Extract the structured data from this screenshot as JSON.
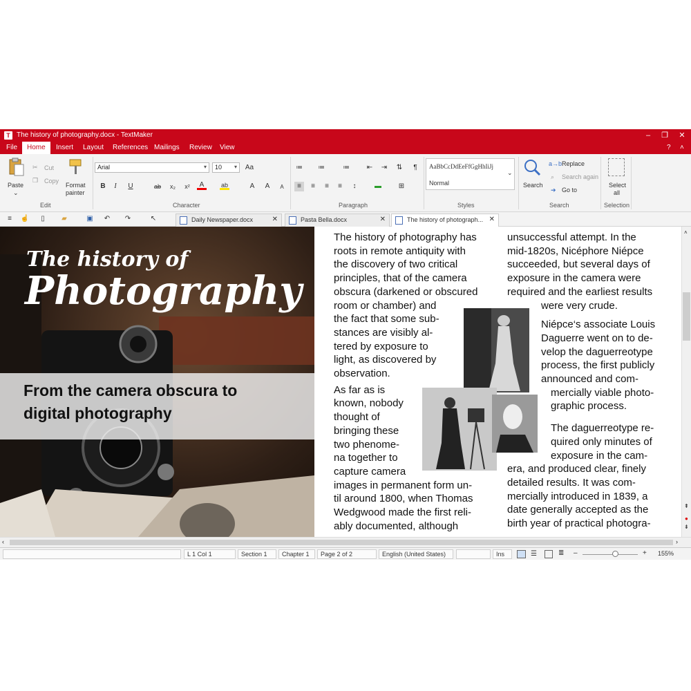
{
  "window": {
    "title": "The history of photography.docx - TextMaker",
    "app_icon": "T"
  },
  "menu": {
    "items": [
      "File",
      "Home",
      "Insert",
      "Layout",
      "References",
      "Mailings",
      "Review",
      "View"
    ],
    "help": "?"
  },
  "ribbon": {
    "edit": {
      "paste": "Paste",
      "cut": "Cut",
      "copy": "Copy",
      "format_painter_1": "Format",
      "format_painter_2": "painter",
      "group": "Edit"
    },
    "character": {
      "font": "Arial",
      "size": "10",
      "group": "Character"
    },
    "paragraph": {
      "group": "Paragraph"
    },
    "styles": {
      "preview": "AaBbCcDdEeFfGgHhIiJj",
      "style": "Normal",
      "group": "Styles"
    },
    "search": {
      "search": "Search",
      "replace": "Replace",
      "search_again": "Search again",
      "go_to": "Go to",
      "group": "Search"
    },
    "selection": {
      "select_1": "Select",
      "select_2": "all",
      "group": "Selection"
    }
  },
  "tabs": [
    {
      "label": "Daily Newspaper.docx"
    },
    {
      "label": "Pasta Bella.docx"
    },
    {
      "label": "The history of photograph..."
    }
  ],
  "document": {
    "title_line1": "The history of",
    "title_line2": "Photography",
    "subtitle_line1": "From the camera obscura to",
    "subtitle_line2": "digital photography",
    "col1": [
      "The history of photography has",
      "roots in remote antiquity with",
      "the discovery of two critical",
      "principles, that of the camera",
      "obscura (darkened or obscured",
      "room or chamber) and",
      "the fact that some sub-",
      "stances are visibly al-",
      "tered by exposure to",
      "light, as discovered by",
      "observation.",
      "As far as is",
      "known, nobody",
      "thought of",
      "bringing these",
      "two phenome-",
      "na together to",
      "capture camera",
      "images in permanent form un-",
      "til around 1800, when Thomas",
      "Wedgwood made the first reli-",
      "ably documented, although"
    ],
    "col2": [
      "unsuccessful attempt. In the",
      "mid-1820s, Nicéphore Niépce",
      "succeeded, but several days of",
      "exposure in the camera were",
      "required and the earliest results",
      "were very crude.",
      "Niépce‘s associate Louis",
      "Daguerre went on to de-",
      "velop the daguerreotype",
      "process, the first publicly",
      "announced and com-",
      "mercially viable photo-",
      "graphic process.",
      "The daguerreotype re-",
      "quired only minutes of",
      "exposure in the cam-",
      "era, and produced clear, finely",
      "detailed results. It was com-",
      "mercially introduced in 1839, a",
      "date generally accepted as the",
      "birth year of practical photogra-"
    ]
  },
  "status": {
    "position": "L 1 Col 1",
    "section": "Section 1",
    "chapter": "Chapter 1",
    "page": "Page 2 of 2",
    "language": "English (United States)",
    "ins": "Ins",
    "zoom": "155%"
  },
  "colors": {
    "accent": "#c8071a"
  }
}
